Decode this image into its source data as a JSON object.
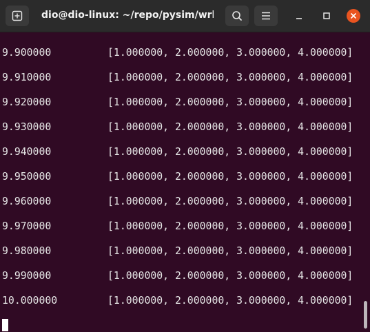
{
  "window": {
    "title": "dio@dio-linux: ~/repo/pysim/wrk..."
  },
  "icons": {
    "new_tab": "new-tab-icon",
    "search": "search-icon",
    "menu": "hamburger-menu-icon",
    "minimize": "minimize-icon",
    "maximize": "maximize-icon",
    "close": "close-icon"
  },
  "colors": {
    "terminal_background": "#300a24",
    "titlebar_background": "#2b2b2b",
    "close_button": "#e95420",
    "text": "#e6e6e6"
  },
  "terminal": {
    "lines": [
      {
        "time": "9.900000",
        "values": "[1.000000, 2.000000, 3.000000, 4.000000]"
      },
      {
        "time": "9.910000",
        "values": "[1.000000, 2.000000, 3.000000, 4.000000]"
      },
      {
        "time": "9.920000",
        "values": "[1.000000, 2.000000, 3.000000, 4.000000]"
      },
      {
        "time": "9.930000",
        "values": "[1.000000, 2.000000, 3.000000, 4.000000]"
      },
      {
        "time": "9.940000",
        "values": "[1.000000, 2.000000, 3.000000, 4.000000]"
      },
      {
        "time": "9.950000",
        "values": "[1.000000, 2.000000, 3.000000, 4.000000]"
      },
      {
        "time": "9.960000",
        "values": "[1.000000, 2.000000, 3.000000, 4.000000]"
      },
      {
        "time": "9.970000",
        "values": "[1.000000, 2.000000, 3.000000, 4.000000]"
      },
      {
        "time": "9.980000",
        "values": "[1.000000, 2.000000, 3.000000, 4.000000]"
      },
      {
        "time": "9.990000",
        "values": "[1.000000, 2.000000, 3.000000, 4.000000]"
      },
      {
        "time": "10.000000",
        "values": "[1.000000, 2.000000, 3.000000, 4.000000]"
      }
    ]
  }
}
